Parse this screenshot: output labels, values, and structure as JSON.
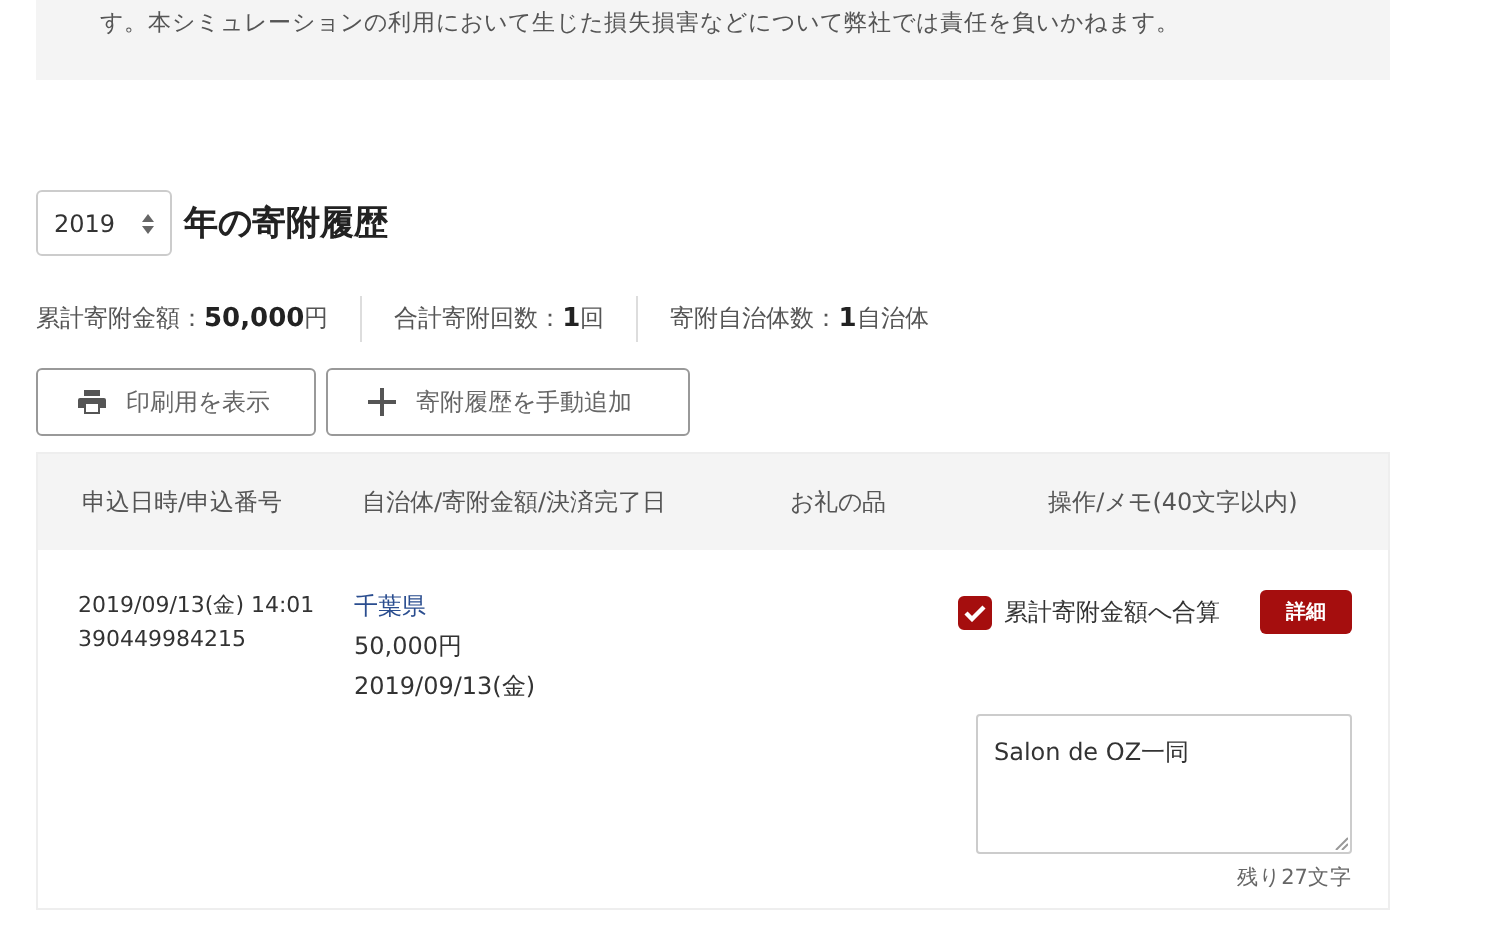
{
  "notice": {
    "text": "す。本シミュレーションの利用において生じた損失損害などについて弊社では責任を負いかねます。"
  },
  "history": {
    "year": "2019",
    "title": "年の寄附履歴"
  },
  "stats": [
    {
      "text": "累計寄附金額：**50,000**円"
    },
    {
      "text": "合計寄附回数：**1**回"
    },
    {
      "text": "寄附自治体数：**1**自治体"
    }
  ],
  "buttons": [
    {
      "label": "印刷用を表示",
      "kind": "print"
    },
    {
      "label": "寄附履歴を手動追加",
      "kind": "add"
    }
  ],
  "table": {
    "columns": [
      "申込日時/申込番号",
      "自治体/寄附金額/決済完了日",
      "お礼の品",
      "操作/メモ(40文字以内)"
    ],
    "rows": [
      {
        "datetime": "2019/09/13(金) 14:01",
        "number": "390449984215",
        "municipality": "千葉県",
        "amount": "50,000円",
        "completed": "2019/09/13(金)",
        "include_label": "累計寄附金額へ合算",
        "checked": true,
        "detail": "詳細",
        "memo": "Salon de OZ一同",
        "remaining": "残り27文字"
      }
    ]
  }
}
